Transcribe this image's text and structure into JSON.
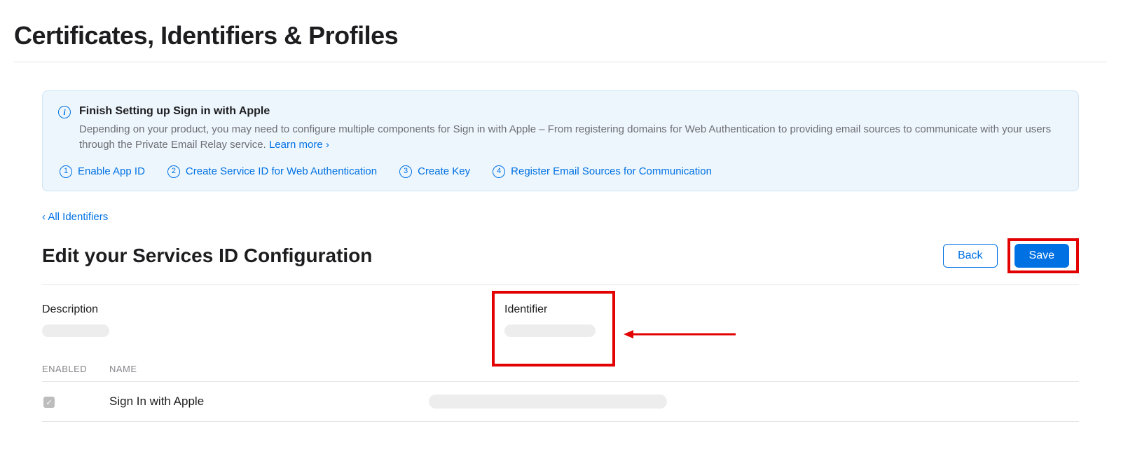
{
  "page": {
    "title": "Certificates, Identifiers & Profiles"
  },
  "info": {
    "icon_glyph": "i",
    "title": "Finish Setting up Sign in with Apple",
    "description": "Depending on your product, you may need to configure multiple components for Sign in with Apple – From registering domains for Web Authentication to providing email sources to communicate with your users through the Private Email Relay service. ",
    "learn_more": "Learn more ›",
    "steps": [
      {
        "num": "1",
        "label": "Enable App ID"
      },
      {
        "num": "2",
        "label": "Create Service ID for Web Authentication"
      },
      {
        "num": "3",
        "label": "Create Key"
      },
      {
        "num": "4",
        "label": "Register Email Sources for Communication"
      }
    ]
  },
  "nav": {
    "back_all": "‹ All Identifiers"
  },
  "section": {
    "title": "Edit your Services ID Configuration",
    "back": "Back",
    "save": "Save"
  },
  "fields": {
    "description_label": "Description",
    "identifier_label": "Identifier"
  },
  "table": {
    "col_enabled": "ENABLED",
    "col_name": "NAME",
    "rows": [
      {
        "enabled": true,
        "name": "Sign In with Apple"
      }
    ]
  }
}
